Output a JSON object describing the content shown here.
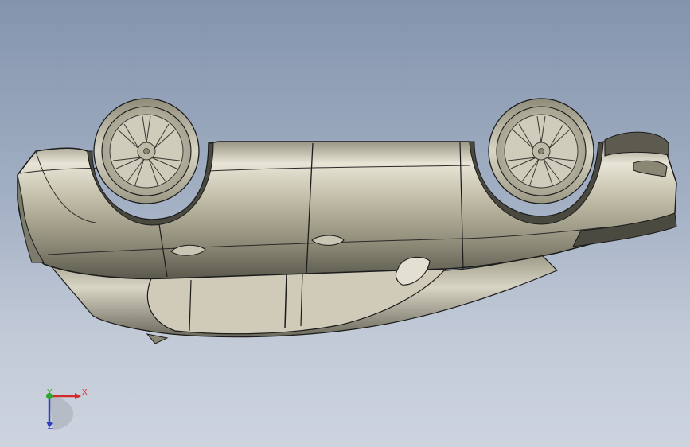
{
  "viewport": {
    "background_top": "#8494ad",
    "background_bottom": "#cdd4df"
  },
  "model": {
    "name": "car-body-model",
    "body_color": "#b9b49f",
    "edge_color": "#1c1c1c",
    "wheel_icon": "alloy-wheel-10-spoke"
  },
  "triad": {
    "x_label": "X",
    "y_label": "Y",
    "z_label": "Z",
    "x_color": "#d42a2a",
    "y_color": "#2fa62f",
    "z_color": "#2f3fbf"
  }
}
